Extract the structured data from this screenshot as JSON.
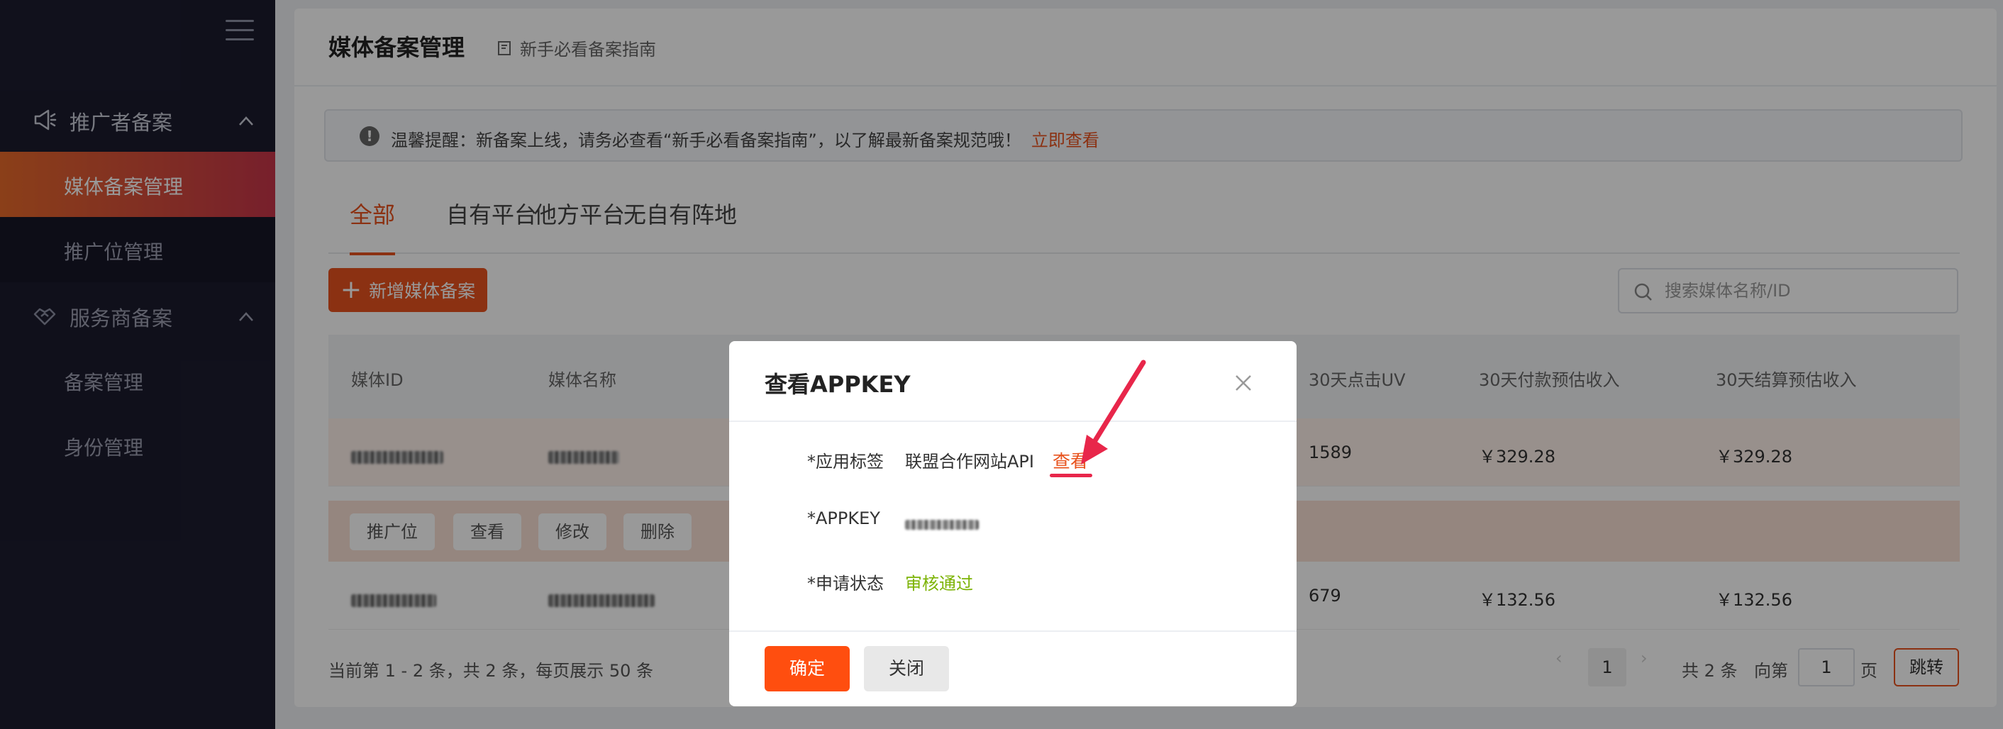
{
  "sidebar": {
    "groups": [
      {
        "label": "推广者备案",
        "icon": "megaphone-icon"
      },
      {
        "label": "服务商备案",
        "icon": "handshake-icon"
      }
    ],
    "items": [
      {
        "label": "媒体备案管理"
      },
      {
        "label": "推广位管理"
      },
      {
        "label": "备案管理"
      },
      {
        "label": "身份管理"
      }
    ]
  },
  "header": {
    "title": "媒体备案管理",
    "guide_link": "新手必看备案指南"
  },
  "notice": {
    "text": "温馨提醒：新备案上线，请务必查看“新手必看备案指南”，以了解最新备案规范哦！",
    "link": "立即查看"
  },
  "tabs": [
    "全部",
    "自有平台",
    "他方平台",
    "无自有阵地"
  ],
  "toolbar": {
    "add_label": "新增媒体备案",
    "search_placeholder": "搜索媒体名称/ID"
  },
  "table": {
    "columns": [
      "媒体ID",
      "媒体名称",
      "30天点击UV",
      "30天付款预估收入",
      "30天结算预估收入"
    ],
    "rows": [
      {
        "uv": "1589",
        "pay_income": "￥329.28",
        "settle_income": "￥329.28"
      },
      {
        "uv": "679",
        "pay_income": "￥132.56",
        "settle_income": "￥132.56"
      }
    ],
    "actions": [
      "推广位",
      "查看",
      "修改",
      "删除"
    ]
  },
  "footer": {
    "info": "当前第 1 - 2 条，共 2 条，每页展示 50 条",
    "current_page": "1",
    "total": "共 2 条",
    "goto_prefix": "向第",
    "goto_value": "1",
    "goto_suffix": "页",
    "jump": "跳转"
  },
  "modal": {
    "title": "查看APPKEY",
    "fields": [
      {
        "label": "*应用标签",
        "value": "联盟合作网站API"
      },
      {
        "label": "*APPKEY",
        "value": ""
      },
      {
        "label": "*申请状态",
        "value": "审核通过"
      }
    ],
    "view_link": "查看",
    "ok": "确定",
    "close": "关闭"
  },
  "colors": {
    "accent": "#e8531e",
    "sidebar_bg": "#1c1c2e",
    "status_ok": "#7cb305",
    "annotation": "#e8264a"
  }
}
